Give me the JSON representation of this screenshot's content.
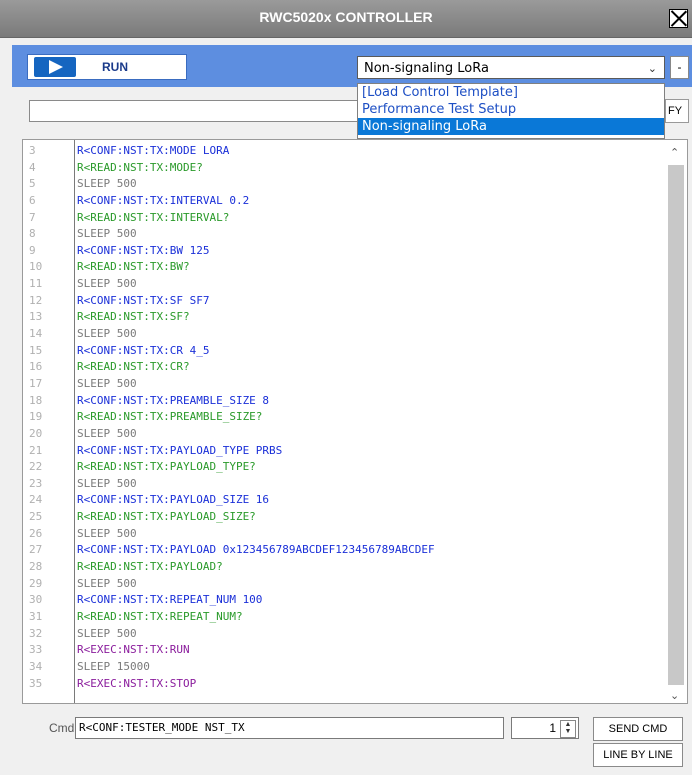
{
  "window": {
    "title": "RWC5020x CONTROLLER"
  },
  "toolbar": {
    "run_label": "RUN",
    "selected_template": "Non-signaling LoRa",
    "minimize_label": "-",
    "dropdown_options": [
      "[Load Control Template]",
      "Performance Test Setup",
      "Non-signaling LoRa"
    ],
    "selected_index": 2,
    "partial_button_label": "FY"
  },
  "colors": {
    "toolbar": "#5d8ee0",
    "conf": "#1a2fd8",
    "read": "#2a9a2a",
    "sleep": "#7a7a7a",
    "exec": "#8a1c9c"
  },
  "editor": {
    "lines": [
      {
        "num": "3",
        "text": "R<CONF:NST:TX:MODE LORA",
        "kind": "conf"
      },
      {
        "num": "4",
        "text": "R<READ:NST:TX:MODE?",
        "kind": "read"
      },
      {
        "num": "5",
        "text": "SLEEP 500",
        "kind": "sleep"
      },
      {
        "num": "6",
        "text": "R<CONF:NST:TX:INTERVAL 0.2",
        "kind": "conf"
      },
      {
        "num": "7",
        "text": "R<READ:NST:TX:INTERVAL?",
        "kind": "read"
      },
      {
        "num": "8",
        "text": "SLEEP 500",
        "kind": "sleep"
      },
      {
        "num": "9",
        "text": "R<CONF:NST:TX:BW 125",
        "kind": "conf"
      },
      {
        "num": "10",
        "text": "R<READ:NST:TX:BW?",
        "kind": "read"
      },
      {
        "num": "11",
        "text": "SLEEP 500",
        "kind": "sleep"
      },
      {
        "num": "12",
        "text": "R<CONF:NST:TX:SF SF7",
        "kind": "conf"
      },
      {
        "num": "13",
        "text": "R<READ:NST:TX:SF?",
        "kind": "read"
      },
      {
        "num": "14",
        "text": "SLEEP 500",
        "kind": "sleep"
      },
      {
        "num": "15",
        "text": "R<CONF:NST:TX:CR 4_5",
        "kind": "conf"
      },
      {
        "num": "16",
        "text": "R<READ:NST:TX:CR?",
        "kind": "read"
      },
      {
        "num": "17",
        "text": "SLEEP 500",
        "kind": "sleep"
      },
      {
        "num": "18",
        "text": "R<CONF:NST:TX:PREAMBLE_SIZE 8",
        "kind": "conf"
      },
      {
        "num": "19",
        "text": "R<READ:NST:TX:PREAMBLE_SIZE?",
        "kind": "read"
      },
      {
        "num": "20",
        "text": "SLEEP 500",
        "kind": "sleep"
      },
      {
        "num": "21",
        "text": "R<CONF:NST:TX:PAYLOAD_TYPE PRBS",
        "kind": "conf"
      },
      {
        "num": "22",
        "text": "R<READ:NST:TX:PAYLOAD_TYPE?",
        "kind": "read"
      },
      {
        "num": "23",
        "text": "SLEEP 500",
        "kind": "sleep"
      },
      {
        "num": "24",
        "text": "R<CONF:NST:TX:PAYLOAD_SIZE 16",
        "kind": "conf"
      },
      {
        "num": "25",
        "text": "R<READ:NST:TX:PAYLOAD_SIZE?",
        "kind": "read"
      },
      {
        "num": "26",
        "text": "SLEEP 500",
        "kind": "sleep"
      },
      {
        "num": "27",
        "text": "R<CONF:NST:TX:PAYLOAD 0x123456789ABCDEF123456789ABCDEF",
        "kind": "conf"
      },
      {
        "num": "28",
        "text": "R<READ:NST:TX:PAYLOAD?",
        "kind": "read"
      },
      {
        "num": "29",
        "text": "SLEEP 500",
        "kind": "sleep"
      },
      {
        "num": "30",
        "text": "R<CONF:NST:TX:REPEAT_NUM 100",
        "kind": "conf"
      },
      {
        "num": "31",
        "text": "R<READ:NST:TX:REPEAT_NUM?",
        "kind": "read"
      },
      {
        "num": "32",
        "text": "SLEEP 500",
        "kind": "sleep"
      },
      {
        "num": "33",
        "text": "R<EXEC:NST:TX:RUN",
        "kind": "exec"
      },
      {
        "num": "34",
        "text": "SLEEP 15000",
        "kind": "sleep"
      },
      {
        "num": "35",
        "text": "R<EXEC:NST:TX:STOP",
        "kind": "exec"
      }
    ]
  },
  "cmd": {
    "label": "Cmd",
    "value": "R<CONF:TESTER_MODE NST_TX",
    "count": "1",
    "send_label": "SEND CMD",
    "line_label": "LINE BY LINE"
  }
}
